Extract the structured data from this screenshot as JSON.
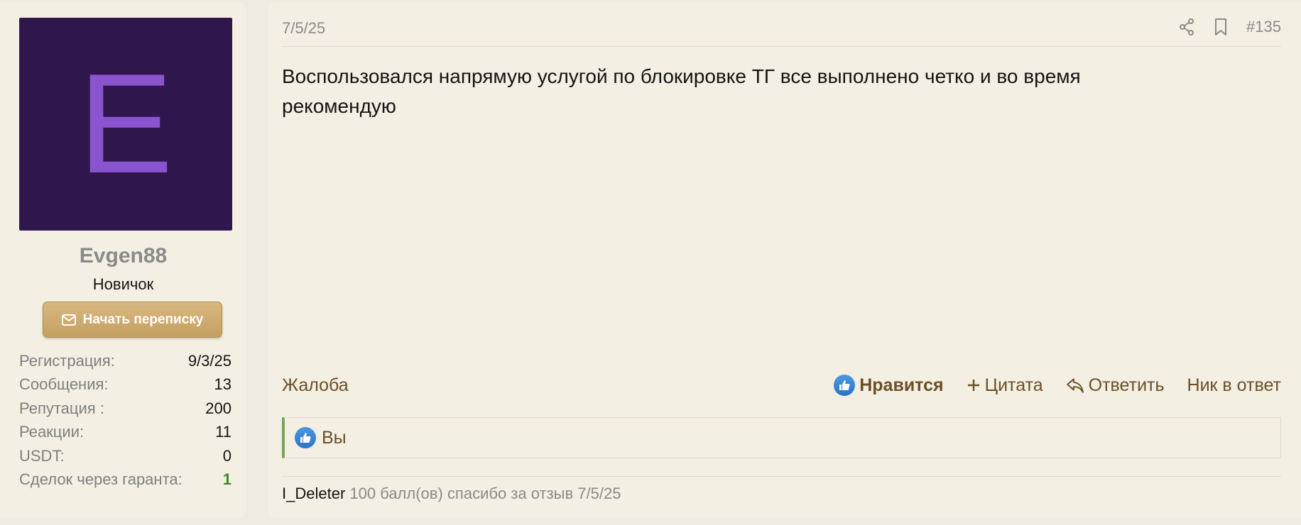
{
  "user": {
    "avatar_letter": "E",
    "name": "Evgen88",
    "title": "Новичок",
    "message_button": "Начать переписку",
    "stats": [
      {
        "label": "Регистрация:",
        "value": "9/3/25"
      },
      {
        "label": "Сообщения:",
        "value": "13"
      },
      {
        "label": "Репутация :",
        "value": "200"
      },
      {
        "label": "Реакции:",
        "value": "11"
      },
      {
        "label": "USDT:",
        "value": "0"
      },
      {
        "label": "Сделок через гаранта:",
        "value": "1"
      }
    ]
  },
  "post": {
    "date": "7/5/25",
    "number": "#135",
    "body_line1": "Воспользовался напрямую услугой по блокировке ТГ все выполнено четко и во время",
    "body_line2": "рекомендую",
    "actions": {
      "report": "Жалоба",
      "like": "Нравится",
      "quote": "Цитата",
      "reply": "Ответить",
      "mention": "Ник в ответ"
    },
    "reactions_text": "Вы",
    "reputation": {
      "user": "I_Deleter",
      "text": "100 балл(ов) спасибо за отзыв 7/5/25"
    }
  },
  "colors": {
    "avatar_bg": "#2f174d",
    "avatar_letter": "#8b54cf",
    "button": "#c49f61",
    "link": "#6b4f25",
    "like_blue": "#2a74c8",
    "reaction_bar": "#7ea45a",
    "highlight_green": "#3a8a2a"
  }
}
